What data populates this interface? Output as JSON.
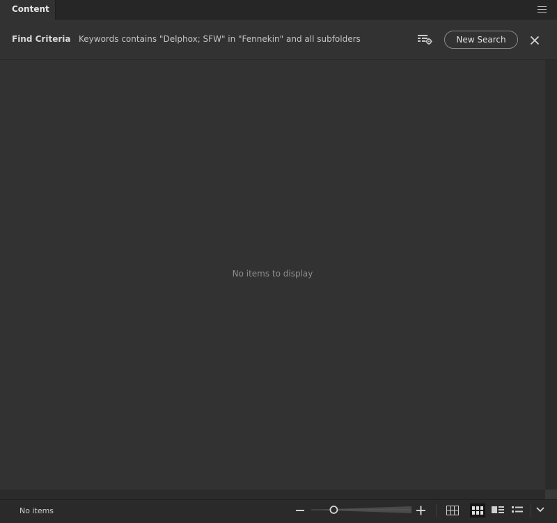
{
  "panel": {
    "tab_label": "Content",
    "menu_icon": "hamburger-menu-icon"
  },
  "find_criteria": {
    "title": "Find Criteria",
    "description": "Keywords contains \"Delphox; SFW\" in \"Fennekin\" and all subfolders",
    "save_icon": "save-as-collection-icon",
    "new_search_label": "New Search",
    "close_icon": "close-icon"
  },
  "content": {
    "empty_message": "No items to display"
  },
  "status_bar": {
    "status_text": "No items",
    "thumbnail_size": 0.2,
    "views": [
      {
        "name": "grid-lock",
        "icon": "lock-grid-icon",
        "active": false
      },
      {
        "name": "thumbnails",
        "icon": "thumbnail-view-icon",
        "active": true
      },
      {
        "name": "details",
        "icon": "details-view-icon",
        "active": false
      },
      {
        "name": "list",
        "icon": "list-view-icon",
        "active": false
      }
    ]
  },
  "colors": {
    "background": "#323232",
    "tab_bar": "#262626",
    "status_bar": "#2a2a2a",
    "text": "#c8c8c8",
    "muted_text": "#8f8f8f"
  }
}
